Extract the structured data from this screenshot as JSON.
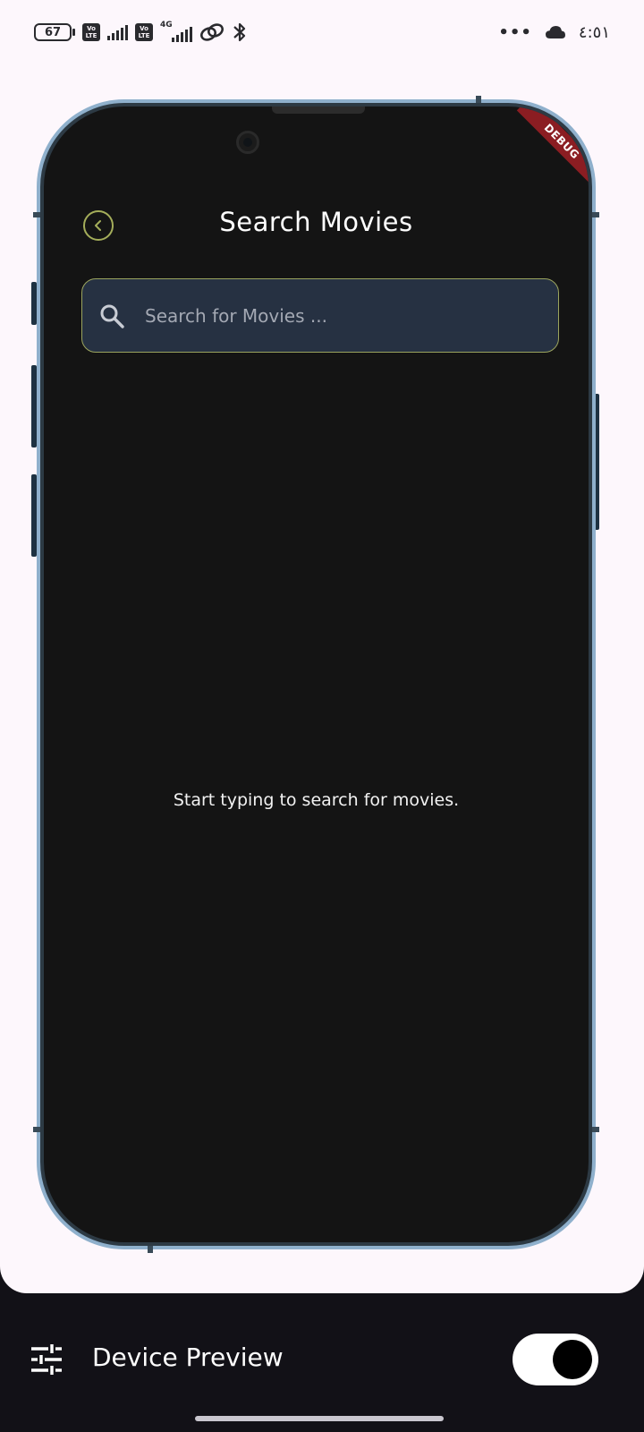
{
  "status_bar": {
    "battery": "67",
    "network_type": "4G",
    "volte_label_top": "Vo",
    "volte_label_bottom": "LTE",
    "overflow": "•••",
    "time": "٤:٥١"
  },
  "app": {
    "debug_banner": "DEBUG",
    "title": "Search Movies",
    "search": {
      "placeholder": "Search for Movies ...",
      "value": ""
    },
    "empty_message": "Start typing to search for movies."
  },
  "device_preview": {
    "label": "Device Preview",
    "toggle_on": true
  },
  "colors": {
    "accent": "#a4ad5a",
    "screen_bg": "#141414",
    "search_bg": "#263142",
    "frame": "#8fb0cc",
    "debug": "#8b1d22"
  }
}
